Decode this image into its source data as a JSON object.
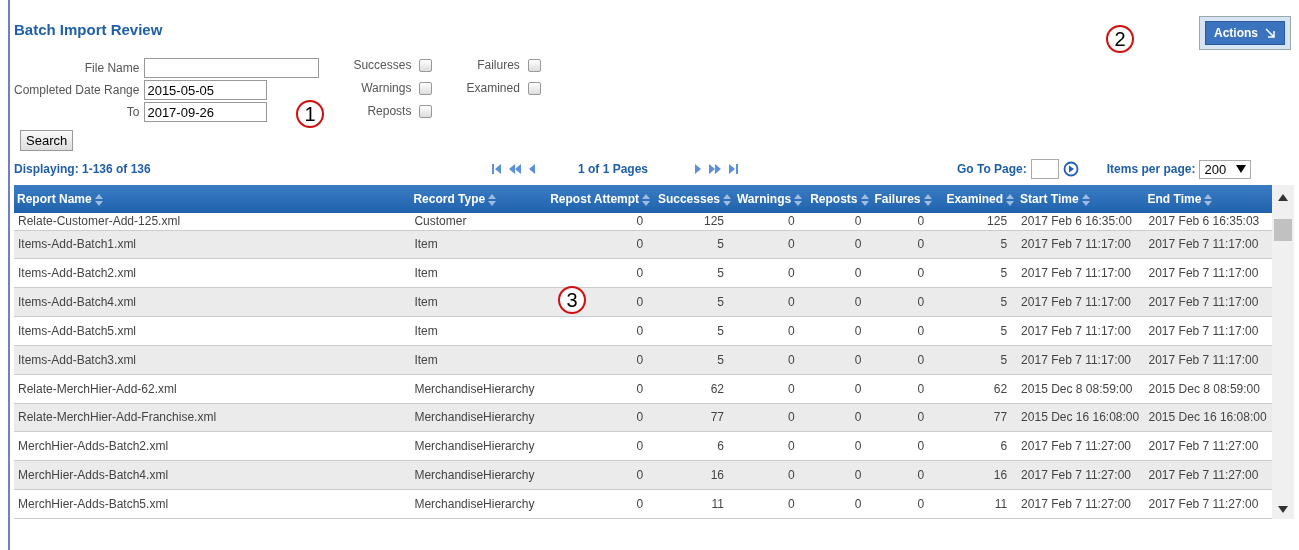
{
  "page": {
    "title": "Batch Import Review",
    "actions_button": "Actions"
  },
  "filters": {
    "fields": [
      {
        "label": "File Name"
      },
      {
        "label": "Completed Date Range",
        "value": "2015-05-05"
      },
      {
        "label": "To",
        "value": "2017-09-26"
      }
    ],
    "checkbox_columns": [
      [
        {
          "label": "Successes",
          "checked": false
        },
        {
          "label": "Warnings",
          "checked": false
        },
        {
          "label": "Reposts",
          "checked": false
        }
      ],
      [
        {
          "label": "Failures",
          "checked": false
        },
        {
          "label": "Examined",
          "checked": false
        }
      ]
    ],
    "search_button": "Search"
  },
  "pager": {
    "displaying": "Displaying: 1-136 of 136",
    "page_info": "1 of 1 Pages",
    "goto_label": "Go To Page:",
    "items_label": "Items per page:",
    "items_value": "200"
  },
  "table": {
    "columns": [
      "Report Name",
      "Record Type",
      "Repost Attempt",
      "Successes",
      "Warnings",
      "Reposts",
      "Failures",
      "Examined",
      "Start Time",
      "End Time"
    ],
    "rows": [
      {
        "cells": [
          "Relate-Customer-Add-125.xml",
          "Customer",
          "0",
          "125",
          "0",
          "0",
          "0",
          "125",
          "2017 Feb 6 16:35:00",
          "2017 Feb 6 16:35:03"
        ]
      },
      {
        "cells": [
          "Items-Add-Batch1.xml",
          "Item",
          "0",
          "5",
          "0",
          "0",
          "0",
          "5",
          "2017 Feb 7 11:17:00",
          "2017 Feb 7 11:17:00"
        ]
      },
      {
        "cells": [
          "Items-Add-Batch2.xml",
          "Item",
          "0",
          "5",
          "0",
          "0",
          "0",
          "5",
          "2017 Feb 7 11:17:00",
          "2017 Feb 7 11:17:00"
        ]
      },
      {
        "cells": [
          "Items-Add-Batch4.xml",
          "Item",
          "0",
          "5",
          "0",
          "0",
          "0",
          "5",
          "2017 Feb 7 11:17:00",
          "2017 Feb 7 11:17:00"
        ]
      },
      {
        "cells": [
          "Items-Add-Batch5.xml",
          "Item",
          "0",
          "5",
          "0",
          "0",
          "0",
          "5",
          "2017 Feb 7 11:17:00",
          "2017 Feb 7 11:17:00"
        ]
      },
      {
        "cells": [
          "Items-Add-Batch3.xml",
          "Item",
          "0",
          "5",
          "0",
          "0",
          "0",
          "5",
          "2017 Feb 7 11:17:00",
          "2017 Feb 7 11:17:00"
        ]
      },
      {
        "cells": [
          "Relate-MerchHier-Add-62.xml",
          "MerchandiseHierarchy",
          "0",
          "62",
          "0",
          "0",
          "0",
          "62",
          "2015 Dec 8 08:59:00",
          "2015 Dec 8 08:59:00"
        ]
      },
      {
        "cells": [
          "Relate-MerchHier-Add-Franchise.xml",
          "MerchandiseHierarchy",
          "0",
          "77",
          "0",
          "0",
          "0",
          "77",
          "2015 Dec 16 16:08:00",
          "2015 Dec 16 16:08:00"
        ]
      },
      {
        "cells": [
          "MerchHier-Adds-Batch2.xml",
          "MerchandiseHierarchy",
          "0",
          "6",
          "0",
          "0",
          "0",
          "6",
          "2017 Feb 7 11:27:00",
          "2017 Feb 7 11:27:00"
        ]
      },
      {
        "cells": [
          "MerchHier-Adds-Batch4.xml",
          "MerchandiseHierarchy",
          "0",
          "16",
          "0",
          "0",
          "0",
          "16",
          "2017 Feb 7 11:27:00",
          "2017 Feb 7 11:27:00"
        ]
      },
      {
        "cells": [
          "MerchHier-Adds-Batch5.xml",
          "MerchandiseHierarchy",
          "0",
          "11",
          "0",
          "0",
          "0",
          "11",
          "2017 Feb 7 11:27:00",
          "2017 Feb 7 11:27:00"
        ]
      }
    ]
  },
  "callouts": [
    "1",
    "2",
    "3"
  ]
}
